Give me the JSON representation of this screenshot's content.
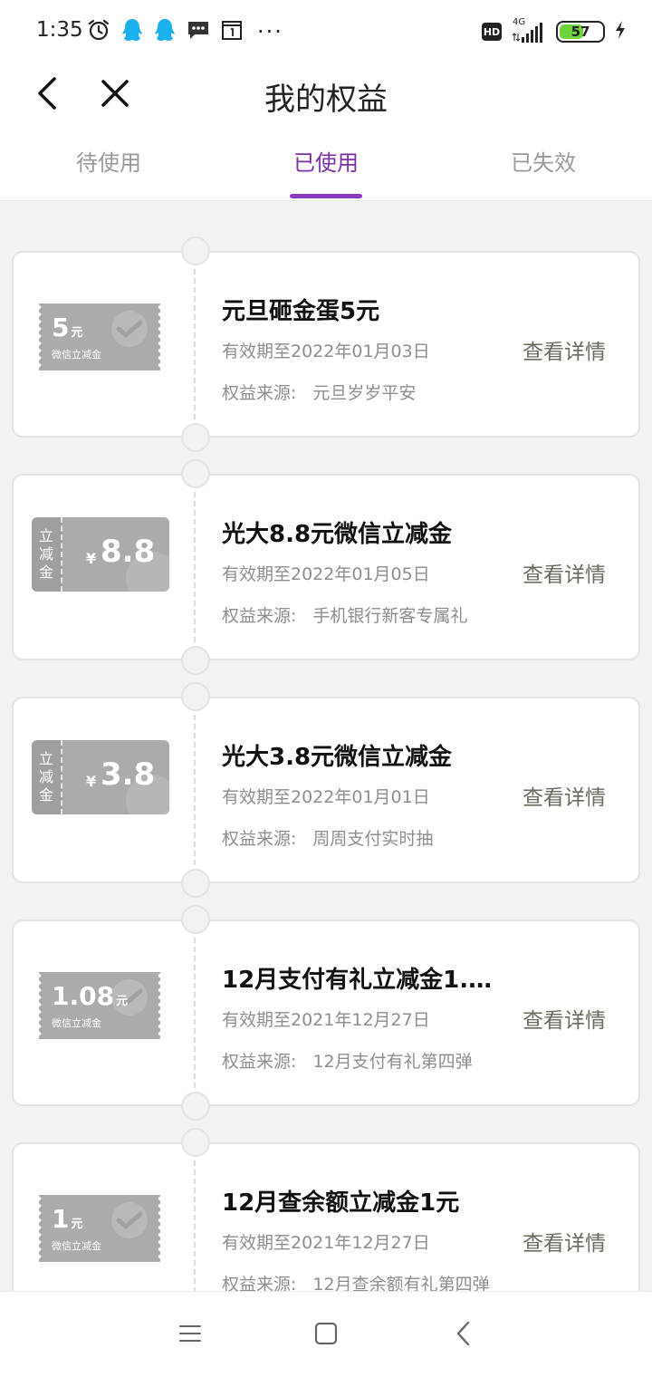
{
  "status_bar": {
    "time": "1:35",
    "network": "4G",
    "hd": "HD",
    "battery": "57",
    "battery_level_percent": 57,
    "icons": [
      "alarm-icon",
      "qq-icon",
      "qq-icon",
      "message-icon",
      "calendar-icon",
      "more-dots-icon",
      "signal-icon",
      "charging-icon"
    ]
  },
  "header": {
    "title": "我的权益",
    "icons": [
      "back-arrow-icon",
      "close-icon"
    ]
  },
  "tabs": {
    "items": [
      {
        "label": "待使用",
        "active": false
      },
      {
        "label": "已使用",
        "active": true
      },
      {
        "label": "已失效",
        "active": false
      }
    ],
    "accent": "#8a3cc0"
  },
  "coupons": [
    {
      "title": "元旦砸金蛋5元",
      "expiry": "有效期至2022年01月03日",
      "source_label": "权益来源:",
      "source": "元旦岁岁平安",
      "action": "查看详情",
      "thumb": {
        "style": "wechat-ticket",
        "amount": "5",
        "unit": "元",
        "subtitle": "微信立减金"
      }
    },
    {
      "title": "光大8.8元微信立减金",
      "expiry": "有效期至2022年01月05日",
      "source_label": "权益来源:",
      "source": "手机银行新客专属礼",
      "action": "查看详情",
      "thumb": {
        "style": "lijian-ticket",
        "side_chars": [
          "立",
          "减",
          "金"
        ],
        "currency": "¥",
        "amount": "8.8"
      }
    },
    {
      "title": "光大3.8元微信立减金",
      "expiry": "有效期至2022年01月01日",
      "source_label": "权益来源:",
      "source": "周周支付实时抽",
      "action": "查看详情",
      "thumb": {
        "style": "lijian-ticket",
        "side_chars": [
          "立",
          "减",
          "金"
        ],
        "currency": "¥",
        "amount": "3.8"
      }
    },
    {
      "title": "12月支付有礼立减金1.…",
      "expiry": "有效期至2021年12月27日",
      "source_label": "权益来源:",
      "source": "12月支付有礼第四弹",
      "action": "查看详情",
      "thumb": {
        "style": "wechat-ticket",
        "amount": "1.08",
        "unit": "元",
        "subtitle": "微信立减金"
      }
    },
    {
      "title": "12月查余额立减金1元",
      "expiry": "有效期至2021年12月27日",
      "source_label": "权益来源:",
      "source": "12月查余额有礼第四弹",
      "action": "查看详情",
      "thumb": {
        "style": "wechat-ticket",
        "amount": "1",
        "unit": "元",
        "subtitle": "微信立减金"
      }
    }
  ],
  "nav_bar": {
    "icons": [
      "menu-icon",
      "home-icon",
      "back-icon"
    ]
  }
}
